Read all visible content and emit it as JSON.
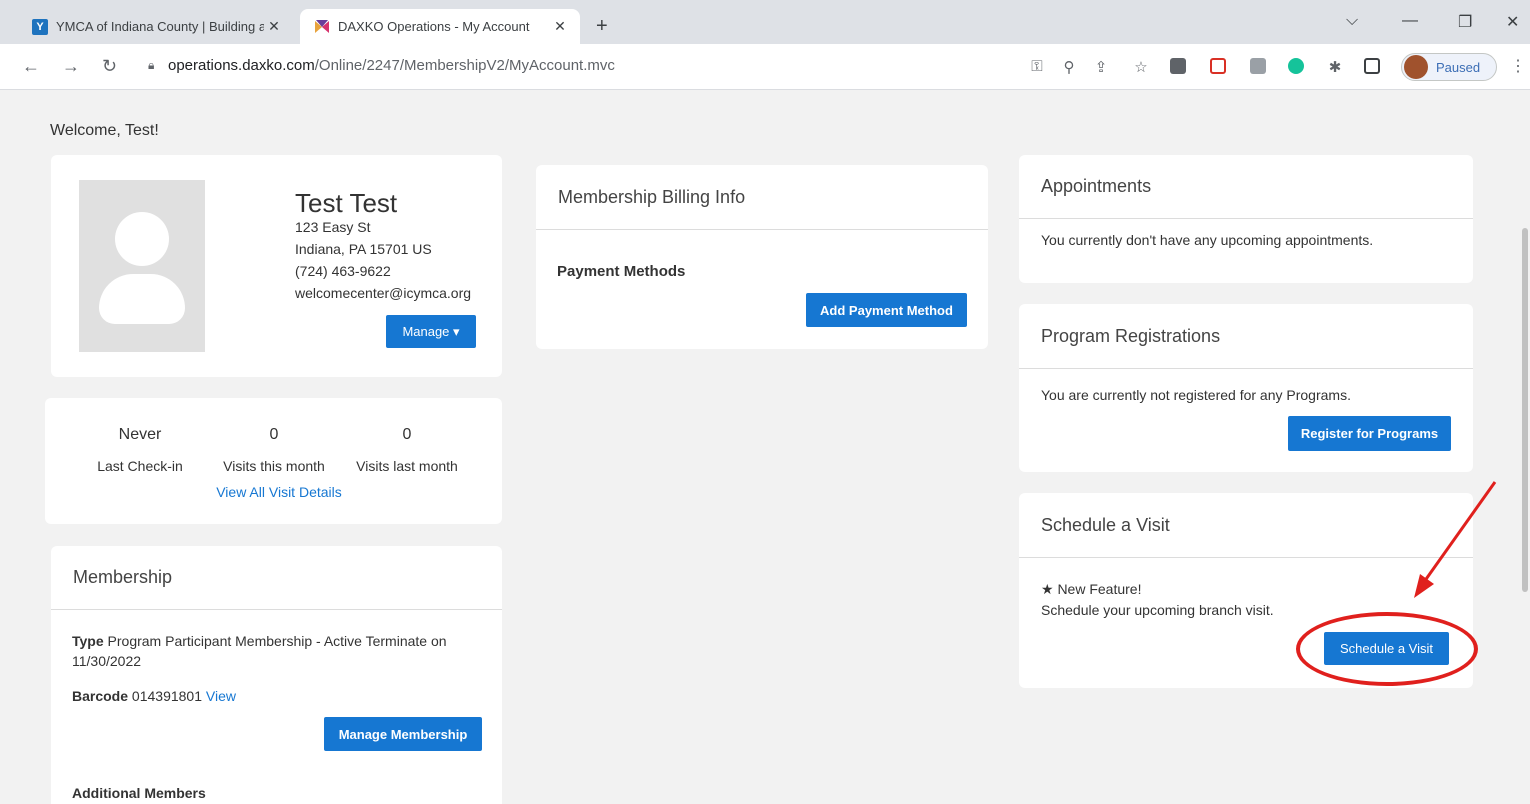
{
  "browser": {
    "tabs": [
      {
        "title": "YMCA of Indiana County | Building a",
        "favicon": "ymca-icon"
      },
      {
        "title": "DAXKO Operations - My Account",
        "favicon": "daxko-icon"
      }
    ],
    "url_host": "operations.daxko.com",
    "url_path": "/Online/2247/MembershipV2/MyAccount.mvc",
    "profile_status": "Paused"
  },
  "page": {
    "welcome": "Welcome, Test!"
  },
  "profile": {
    "name": "Test Test",
    "address1": "123 Easy St",
    "address2": "Indiana,  PA  15701  US",
    "phone": "(724)  463-9622",
    "email": "welcomecenter@icymca.org",
    "manage_label": "Manage ▾"
  },
  "visits": {
    "last_checkin_value": "Never",
    "last_checkin_label": "Last Check-in",
    "this_month_value": "0",
    "this_month_label": "Visits this month",
    "last_month_value": "0",
    "last_month_label": "Visits last month",
    "view_all_label": "View All Visit Details"
  },
  "membership": {
    "header": "Membership",
    "type_label": "Type",
    "type_value": "Program Participant Membership - Active Terminate on",
    "type_value_2": "11/30/2022",
    "barcode_label": "Barcode",
    "barcode_value": "014391801",
    "view_label": "View",
    "manage_label": "Manage Membership",
    "additional_members": "Additional Members"
  },
  "billing": {
    "header": "Membership Billing Info",
    "payment_methods": "Payment Methods",
    "add_payment_label": "Add Payment Method"
  },
  "appointments": {
    "header": "Appointments",
    "message": "You currently don't have any upcoming appointments."
  },
  "programs": {
    "header": "Program Registrations",
    "message": "You are currently not registered for any Programs.",
    "register_label": "Register for Programs"
  },
  "schedule": {
    "header": "Schedule a Visit",
    "feature": "★  New Feature!",
    "message": "Schedule your upcoming branch visit.",
    "button_label": "Schedule a Visit"
  },
  "colors": {
    "accent": "#1677d2",
    "annotation": "#e0201d"
  }
}
